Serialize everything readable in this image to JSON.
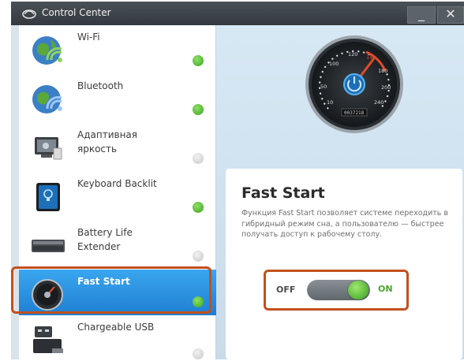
{
  "window": {
    "title": "Control Center",
    "minimize_label": "_",
    "close_label": "✕"
  },
  "sidebar": {
    "items": [
      {
        "label": "Wi-Fi",
        "icon": "wifi-globe-icon",
        "state": "on"
      },
      {
        "label": "Bluetooth",
        "icon": "bluetooth-globe-icon",
        "state": "on"
      },
      {
        "label": "Адаптивная яркость",
        "icon": "adaptive-brightness-icon",
        "state": "off"
      },
      {
        "label": "Keyboard Backlit",
        "icon": "keyboard-backlight-icon",
        "state": "on"
      },
      {
        "label": "Battery Life Extender",
        "icon": "battery-icon",
        "state": "off"
      },
      {
        "label": "Fast Start",
        "icon": "speedometer-icon",
        "state": "on",
        "selected": true
      },
      {
        "label": "Chargeable USB",
        "icon": "usb-icon",
        "state": "off"
      }
    ]
  },
  "detail": {
    "title": "Fast Start",
    "description": "Функция Fast Start позволяет системе переходить в гибридный режим сна, а пользователю — быстрее получать доступ к рабочему столу.",
    "toggle": {
      "off_label": "OFF",
      "on_label": "ON",
      "value": "on"
    },
    "gauge": {
      "ticks": [
        "10",
        "50",
        "100",
        "120",
        "140",
        "180",
        "200",
        "240"
      ],
      "odometer": "0037218"
    }
  },
  "colors": {
    "accent_blue": "#2a8fe0",
    "status_on": "#52b634",
    "highlight_border": "#c3501c"
  }
}
